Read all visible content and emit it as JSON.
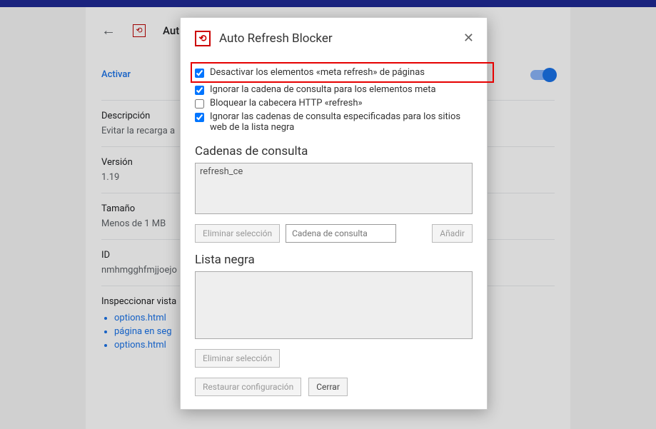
{
  "page": {
    "header_title": "Aut",
    "activar_label": "Activar",
    "desc_label": "Descripción",
    "desc_value": "Evitar la recarga a",
    "version_label": "Versión",
    "version_value": "1.19",
    "size_label": "Tamaño",
    "size_value": "Menos de 1 MB",
    "id_label": "ID",
    "id_value": "nmhmgghfmjjoejo",
    "views_label": "Inspeccionar vista",
    "views": [
      "options.html",
      "página en seg",
      "options.html"
    ]
  },
  "modal": {
    "title": "Auto Refresh Blocker",
    "opt1": "Desactivar los elementos «meta refresh» de páginas",
    "opt2": "Ignorar la cadena de consulta para los elementos meta",
    "opt3": "Bloquear la cabecera HTTP «refresh»",
    "opt4": "Ignorar las cadenas de consulta especificadas para los sitios web de la lista negra",
    "query_heading": "Cadenas de consulta",
    "query_list_item": "refresh_ce",
    "delete_selection": "Eliminar selección",
    "query_placeholder": "Cadena de consulta",
    "add_btn": "Añadir",
    "blacklist_heading": "Lista negra",
    "restore_btn": "Restaurar configuración",
    "close_btn": "Cerrar"
  }
}
